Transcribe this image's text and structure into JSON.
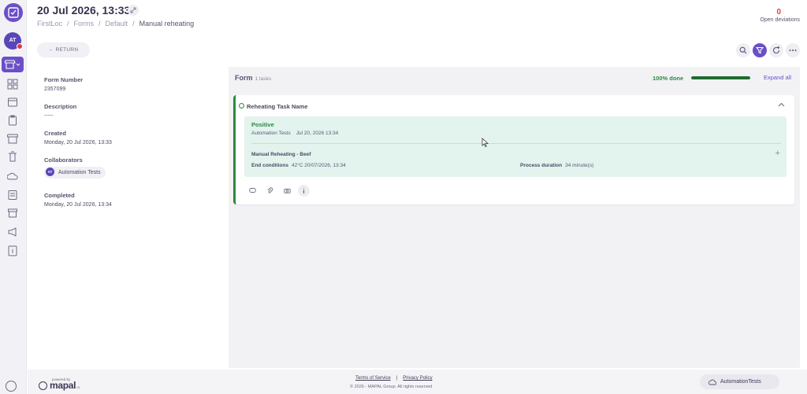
{
  "header": {
    "title": "20 Jul 2026, 13:33",
    "breadcrumbs": [
      "FirstLoc",
      "Forms",
      "Default",
      "Manual reheating"
    ],
    "open_deviations_count": "0",
    "open_deviations_label": "Open deviations"
  },
  "user": {
    "initials": "AT"
  },
  "toolbar": {
    "return_label": "← RETURN"
  },
  "details": {
    "form_number_label": "Form Number",
    "form_number": "2357099",
    "description_label": "Description",
    "description": "-----",
    "created_label": "Created",
    "created": "Monday, 20 Jul 2026, 13:33",
    "collaborators_label": "Collaborators",
    "collaborator": {
      "initials": "AT",
      "name": "Automation Tests"
    },
    "completed_label": "Completed",
    "completed": "Monday, 20 Jul 2026, 13:34"
  },
  "form": {
    "title": "Form",
    "tasks_count": "1 tasks",
    "progress_label": "100% done",
    "progress_value": 1.0,
    "expand_all": "Expand all",
    "task": {
      "name": "Reheating Task Name",
      "status": "Positive",
      "author": "Automation Tests",
      "date": "Jul 20, 2026 13:34",
      "subtask_title": "Manual Reheating - Beef",
      "end_conditions_label": "End conditions",
      "end_conditions_value": "42°C 20/07/2026, 13:34",
      "process_duration_label": "Process duration",
      "process_duration_value": "34 minute(s)"
    }
  },
  "footer": {
    "powered_by": "powered by",
    "brand": "mapal",
    "brand_suffix": "os",
    "terms": "Terms of Service",
    "privacy": "Privacy Policy",
    "separator": "|",
    "copyright": "© 2026 - MAPAL Group. All rights reserved",
    "org_name": "AutomationTests"
  },
  "colors": {
    "accent": "#6b4fc8",
    "success": "#2a8a3e",
    "alert": "#e4412d",
    "result_bg": "#e3f3ee"
  }
}
